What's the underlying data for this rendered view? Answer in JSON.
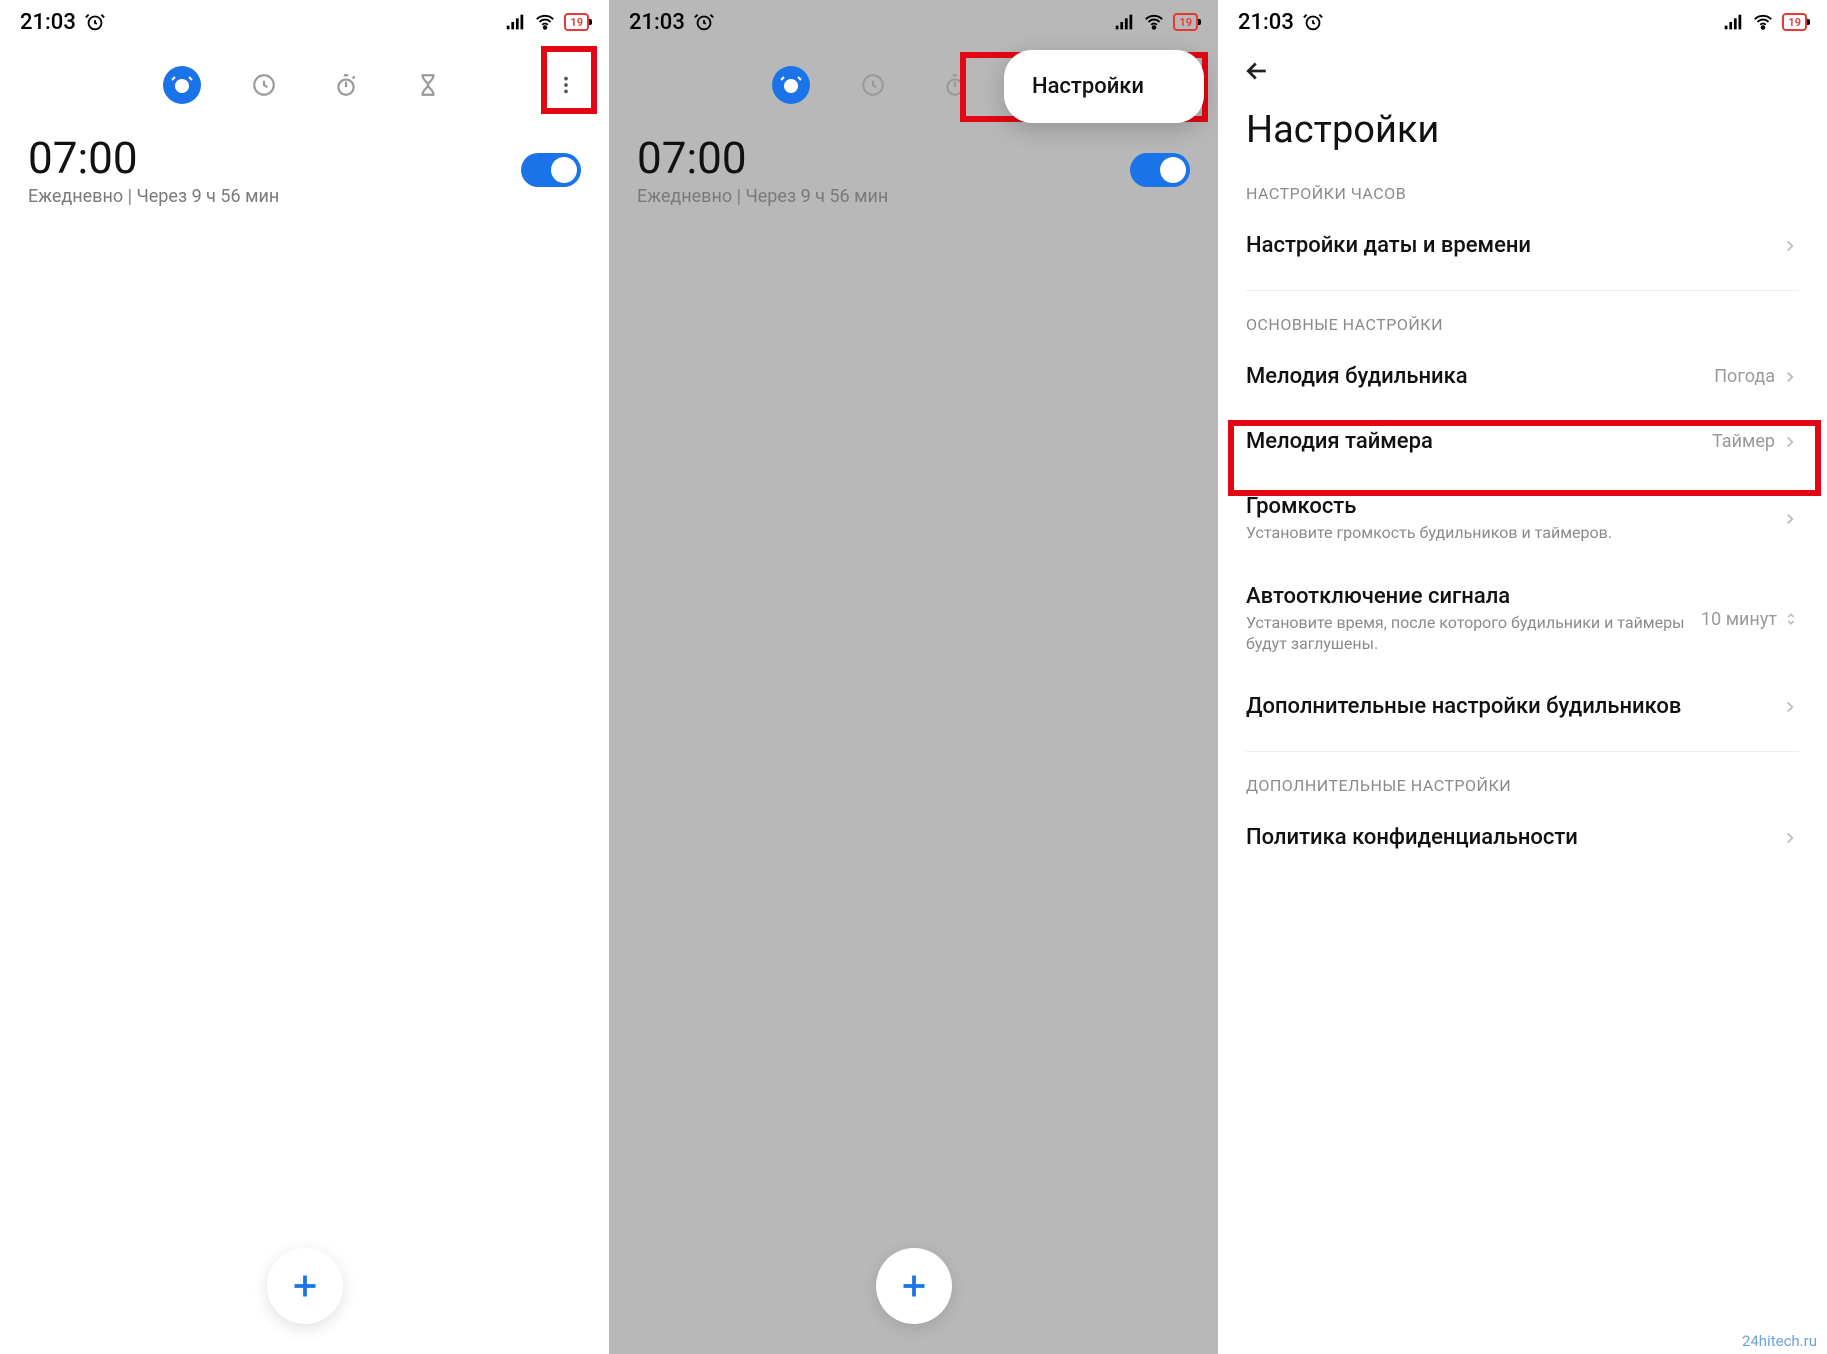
{
  "statusbar": {
    "time": "21:03",
    "battery": "19"
  },
  "tabs": {
    "alarm": "alarm",
    "clock": "clock",
    "stopwatch": "stopwatch",
    "timer": "timer"
  },
  "alarm": {
    "time": "07:00",
    "subtitle": "Ежедневно  |  Через 9 ч 56 мин"
  },
  "popup": {
    "settings": "Настройки"
  },
  "settings": {
    "title": "Настройки",
    "section_clock": "НАСТРОЙКИ ЧАСОВ",
    "datetime": "Настройки даты и времени",
    "section_main": "ОСНОВНЫЕ НАСТРОЙКИ",
    "alarm_sound": {
      "label": "Мелодия будильника",
      "value": "Погода"
    },
    "timer_sound": {
      "label": "Мелодия таймера",
      "value": "Таймер"
    },
    "volume": {
      "label": "Громкость",
      "sub": "Установите громкость будильников и таймеров."
    },
    "auto_off": {
      "label": "Автоотключение сигнала",
      "sub": "Установите время, после которого будильники и таймеры будут заглушены.",
      "value": "10 минут"
    },
    "advanced_alarms": "Дополнительные настройки будильников",
    "section_extra": "ДОПОЛНИТЕЛЬНЫЕ НАСТРОЙКИ",
    "privacy": "Политика конфиденциальности"
  },
  "watermark": "24hitech.ru"
}
